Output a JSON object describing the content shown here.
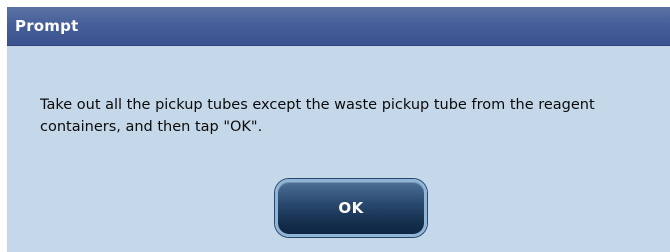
{
  "dialog": {
    "title": "Prompt",
    "message": "Take out all the pickup tubes except the waste pickup tube from the reagent containers, and then tap \"OK\".",
    "ok_label": "OK"
  },
  "colors": {
    "title_bar": "#46609a",
    "dialog_background": "#c5d8e9",
    "button_background": "#1d3758",
    "button_border": "#8fb4d6",
    "title_text": "#ffffff"
  }
}
